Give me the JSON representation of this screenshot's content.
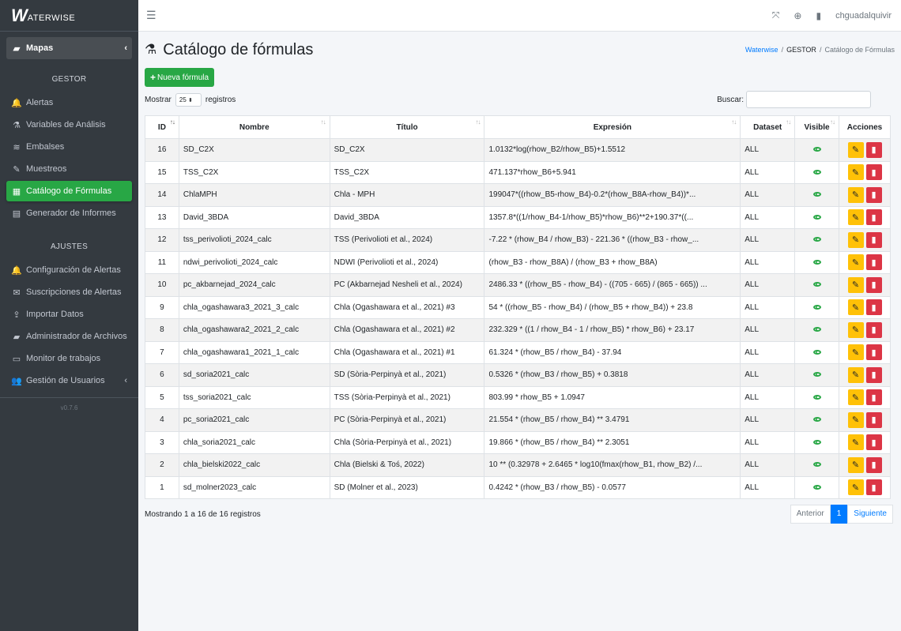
{
  "brand": {
    "logo": "W",
    "name": "ATERWISE"
  },
  "sidebar": {
    "mapas": "Mapas",
    "gestor_header": "GESTOR",
    "gestor_items": [
      {
        "label": "Alertas",
        "icon": "bell-icon",
        "glyph": "🔔"
      },
      {
        "label": "Variables de Análisis",
        "icon": "flask-icon",
        "glyph": "⚗"
      },
      {
        "label": "Embalses",
        "icon": "water-icon",
        "glyph": "≋"
      },
      {
        "label": "Muestreos",
        "icon": "eyedropper-icon",
        "glyph": "✎"
      },
      {
        "label": "Catálogo de Fórmulas",
        "icon": "calculator-icon",
        "glyph": "▦",
        "active": true
      },
      {
        "label": "Generador de Informes",
        "icon": "file-icon",
        "glyph": "▤"
      }
    ],
    "ajustes_header": "AJUSTES",
    "ajustes_items": [
      {
        "label": "Configuración de Alertas",
        "icon": "bell-icon",
        "glyph": "🔔"
      },
      {
        "label": "Suscripciones de Alertas",
        "icon": "envelope-icon",
        "glyph": "✉"
      },
      {
        "label": "Importar Datos",
        "icon": "upload-icon",
        "glyph": "⇪"
      },
      {
        "label": "Administrador de Archivos",
        "icon": "folder-icon",
        "glyph": "▰"
      },
      {
        "label": "Monitor de trabajos",
        "icon": "monitor-icon",
        "glyph": "▭"
      },
      {
        "label": "Gestión de Usuarios",
        "icon": "users-icon",
        "glyph": "👥",
        "caret": true
      }
    ],
    "version": "v0.7.6"
  },
  "topbar": {
    "user": "chguadalquivir"
  },
  "page": {
    "title": "Catálogo de fórmulas",
    "breadcrumb": {
      "home": "Waterwise",
      "section": "GESTOR",
      "current": "Catálogo de Fórmulas"
    },
    "new_button": "Nueva fórmula",
    "show_prefix": "Mostrar",
    "show_value": "25",
    "show_suffix": "registros",
    "search_label": "Buscar:",
    "search_value": ""
  },
  "table": {
    "headers": [
      "ID",
      "Nombre",
      "Título",
      "Expresión",
      "Dataset",
      "Visible",
      "Acciones"
    ],
    "rows": [
      {
        "id": "16",
        "nombre": "SD_C2X",
        "titulo": "SD_C2X",
        "expresion": "1.0132*log(rhow_B2/rhow_B5)+1.5512",
        "dataset": "ALL"
      },
      {
        "id": "15",
        "nombre": "TSS_C2X",
        "titulo": "TSS_C2X",
        "expresion": "471.137*rhow_B6+5.941",
        "dataset": "ALL"
      },
      {
        "id": "14",
        "nombre": "ChlaMPH",
        "titulo": "Chla - MPH",
        "expresion": "199047*((rhow_B5-rhow_B4)-0.2*(rhow_B8A-rhow_B4))*...",
        "dataset": "ALL"
      },
      {
        "id": "13",
        "nombre": "David_3BDA",
        "titulo": "David_3BDA",
        "expresion": "1357.8*((1/rhow_B4-1/rhow_B5)*rhow_B6)**2+190.37*((...",
        "dataset": "ALL"
      },
      {
        "id": "12",
        "nombre": "tss_perivolioti_2024_calc",
        "titulo": "TSS (Perivolioti et al., 2024)",
        "expresion": "-7.22 * (rhow_B4 / rhow_B3) - 221.36 * ((rhow_B3 - rhow_...",
        "dataset": "ALL"
      },
      {
        "id": "11",
        "nombre": "ndwi_perivolioti_2024_calc",
        "titulo": "NDWI (Perivolioti et al., 2024)",
        "expresion": "(rhow_B3 - rhow_B8A) / (rhow_B3 + rhow_B8A)",
        "dataset": "ALL"
      },
      {
        "id": "10",
        "nombre": "pc_akbarnejad_2024_calc",
        "titulo": "PC (Akbarnejad Nesheli et al., 2024)",
        "expresion": "2486.33 * ((rhow_B5 - rhow_B4) - ((705 - 665) / (865 - 665)) ...",
        "dataset": "ALL"
      },
      {
        "id": "9",
        "nombre": "chla_ogashawara3_2021_3_calc",
        "titulo": "Chla (Ogashawara et al., 2021) #3",
        "expresion": "54 * ((rhow_B5 - rhow_B4) / (rhow_B5 + rhow_B4)) + 23.8",
        "dataset": "ALL"
      },
      {
        "id": "8",
        "nombre": "chla_ogashawara2_2021_2_calc",
        "titulo": "Chla (Ogashawara et al., 2021) #2",
        "expresion": "232.329 * ((1 / rhow_B4 - 1 / rhow_B5) * rhow_B6) + 23.17",
        "dataset": "ALL"
      },
      {
        "id": "7",
        "nombre": "chla_ogashawara1_2021_1_calc",
        "titulo": "Chla (Ogashawara et al., 2021) #1",
        "expresion": "61.324 * (rhow_B5 / rhow_B4) - 37.94",
        "dataset": "ALL"
      },
      {
        "id": "6",
        "nombre": "sd_soria2021_calc",
        "titulo": "SD (Sòria-Perpinyà et al., 2021)",
        "expresion": "0.5326 * (rhow_B3 / rhow_B5) + 0.3818",
        "dataset": "ALL"
      },
      {
        "id": "5",
        "nombre": "tss_soria2021_calc",
        "titulo": "TSS (Sòria-Perpinyà et al., 2021)",
        "expresion": "803.99 * rhow_B5 + 1.0947",
        "dataset": "ALL"
      },
      {
        "id": "4",
        "nombre": "pc_soria2021_calc",
        "titulo": "PC (Sòria-Perpinyà et al., 2021)",
        "expresion": "21.554 * (rhow_B5 / rhow_B4) ** 3.4791",
        "dataset": "ALL"
      },
      {
        "id": "3",
        "nombre": "chla_soria2021_calc",
        "titulo": "Chla (Sòria-Perpinyà et al., 2021)",
        "expresion": "19.866 * (rhow_B5 / rhow_B4) ** 2.3051",
        "dataset": "ALL"
      },
      {
        "id": "2",
        "nombre": "chla_bielski2022_calc",
        "titulo": "Chla (Bielski & Toś, 2022)",
        "expresion": "10 ** (0.32978 + 2.6465 * log10(fmax(rhow_B1, rhow_B2) /...",
        "dataset": "ALL"
      },
      {
        "id": "1",
        "nombre": "sd_molner2023_calc",
        "titulo": "SD (Molner et al., 2023)",
        "expresion": "0.4242 * (rhow_B3 / rhow_B5) - 0.0577",
        "dataset": "ALL"
      }
    ]
  },
  "footer": {
    "info": "Mostrando 1 a 16 de 16 registros",
    "prev": "Anterior",
    "page": "1",
    "next": "Siguiente"
  },
  "colors": {
    "accent": "#28a745",
    "sidebar_bg": "#343a40",
    "edit": "#ffc107",
    "delete": "#dc3545",
    "link": "#007bff"
  }
}
